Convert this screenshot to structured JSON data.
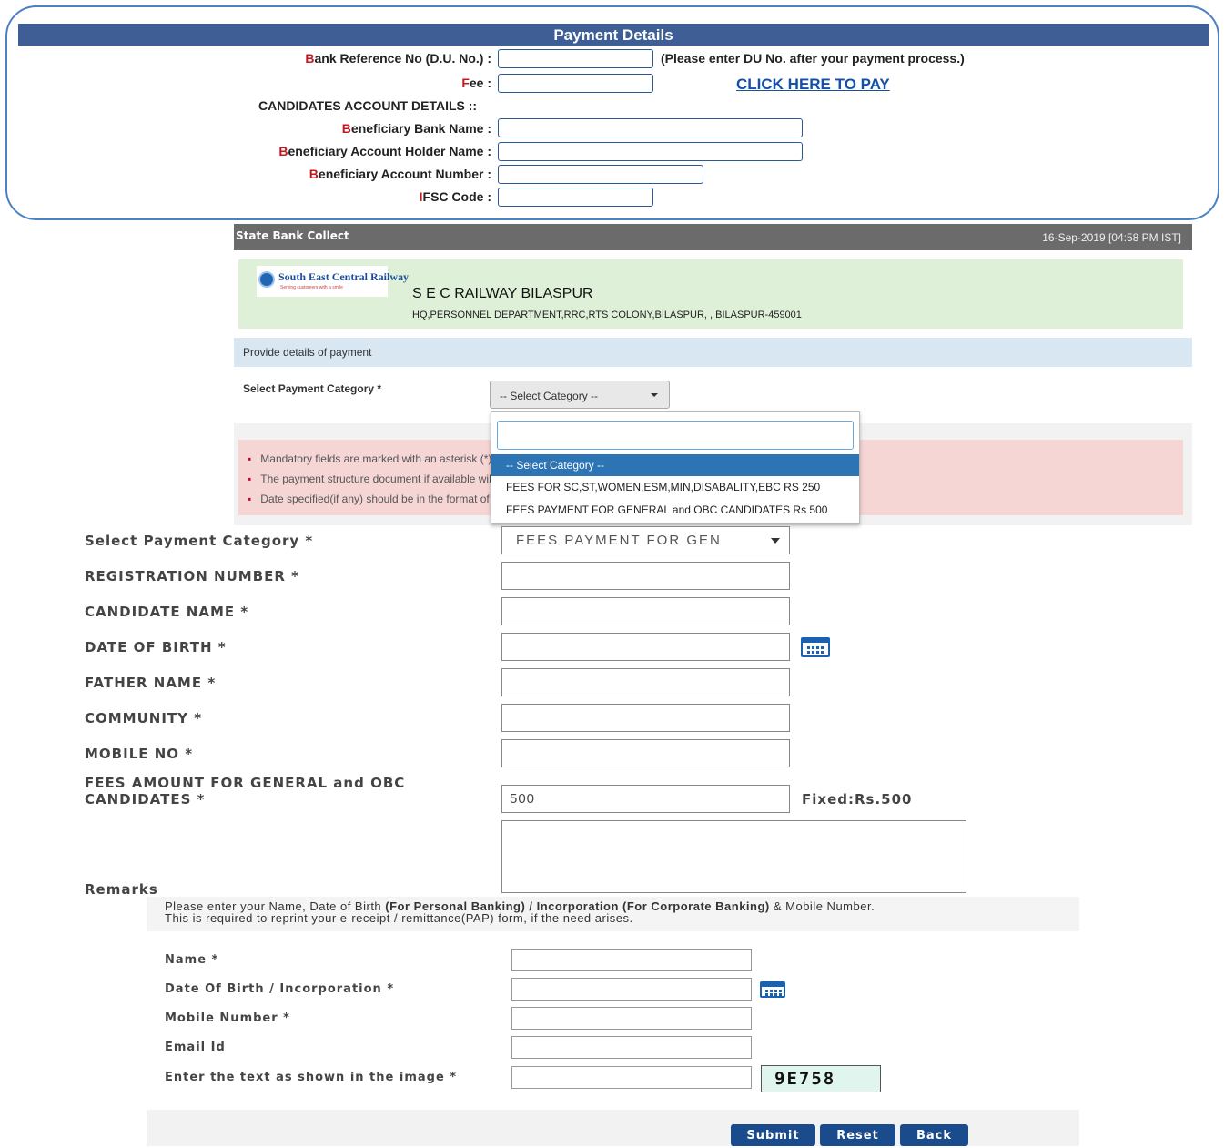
{
  "payment_details": {
    "title": "Payment Details",
    "bank_ref_label_first": "B",
    "bank_ref_label_rest": "ank Reference No (D.U. No.) :",
    "du_note": "(Please enter DU No. after your payment process.)",
    "fee_label_first": "F",
    "fee_label_rest": "ee :",
    "pay_link": "CLICK HERE TO PAY",
    "account_section": "CANDIDATES ACCOUNT DETAILS ::",
    "bank_name_first": "B",
    "bank_name_rest": "eneficiary Bank Name :",
    "holder_first": "B",
    "holder_rest": "eneficiary Account Holder Name :",
    "acct_first": "B",
    "acct_rest": "eneficiary Account Number :",
    "ifsc_first": "I",
    "ifsc_rest": "FSC Code :"
  },
  "sbi_collect": {
    "title": "State Bank Collect",
    "datetime": "16-Sep-2019 [04:58 PM IST]",
    "logo_name": "South East Central Railway",
    "logo_tagline": "Serving customers with a smile",
    "merchant_name": "S E C RAILWAY BILASPUR",
    "merchant_address": "HQ,PERSONNEL DEPARTMENT,RRC,RTS COLONY,BILASPUR, , BILASPUR-459001",
    "provide_text": "Provide details of payment",
    "category_label": "Select Payment Category *",
    "category_selected": "-- Select Category --",
    "notices": [
      "Mandatory fields are marked with an asterisk (*)",
      "The payment structure document if available will",
      "Date specified(if any) should be in the format of '"
    ],
    "dropdown_options": [
      "-- Select Category --",
      "FEES FOR SC,ST,WOMEN,ESM,MIN,DISABALITY,EBC RS 250",
      "FEES PAYMENT FOR GENERAL and OBC CANDIDATES Rs 500"
    ]
  },
  "form": {
    "category_label": "Select Payment Category *",
    "category_value": "FEES PAYMENT FOR GEN",
    "reg_label": "REGISTRATION NUMBER *",
    "name_label": "CANDIDATE NAME *",
    "dob_label": "DATE OF BIRTH *",
    "father_label": "FATHER NAME *",
    "community_label": "COMMUNITY *",
    "mobile_label": "MOBILE NO *",
    "fees_label_line1": "FEES AMOUNT FOR GENERAL and OBC",
    "fees_label_line2": "CANDIDATES *",
    "fees_value": "500",
    "fixed_text": "Fixed:Rs.500",
    "remarks_label": "Remarks"
  },
  "personal": {
    "info_line1_a": "Please enter your Name, Date of Birth ",
    "info_line1_b": "(For Personal Banking) / Incorporation (For Corporate Banking)",
    "info_line1_c": "  & Mobile Number.",
    "info_line2": "This is required to reprint your e-receipt / remittance(PAP) form, if the need arises.",
    "name_label": "Name *",
    "dob_label": "Date Of Birth / Incorporation *",
    "mobile_label": "Mobile Number *",
    "email_label": "Email Id",
    "captcha_label": "Enter the text as shown in the image *",
    "captcha_text": "9E758"
  },
  "buttons": {
    "submit": "Submit",
    "reset": "Reset",
    "back": "Back"
  }
}
